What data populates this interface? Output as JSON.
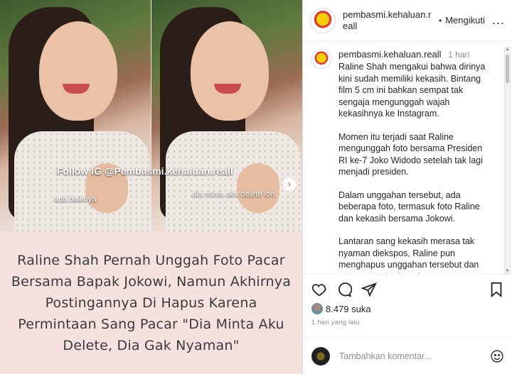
{
  "media": {
    "overlay_follow": "Follow IG @Pembasmi.kehaluan.reall",
    "caption_left": "ada baiknya",
    "caption_right": "dia minta aku delete lon",
    "next_icon": "chevron-right-icon",
    "headline": "Raline Shah Pernah Unggah Foto Pacar Bersama Bapak Jokowi, Namun Akhirnya Postingannya Di Hapus Karena Permintaan Sang Pacar \"Dia Minta Aku Delete, Dia Gak Nyaman\"",
    "headline_bg": "#f6e1e1"
  },
  "header": {
    "username": "pembasmi.kehaluan.reall",
    "separator": "•",
    "follow_label": "Mengikuti",
    "more_label": "..."
  },
  "post": {
    "username": "pembasmi.kehaluan.reall",
    "time": "1 hari",
    "paragraphs": [
      "Raline Shah mengakui bahwa dirinya kini sudah memiliki kekasih. Bintang film 5 cm ini bahkan sempat tak sengaja mengunggah wajah kekasihnya ke Instagram.",
      "Momen itu terjadi saat Raline mengunggah foto bersama Presiden RI ke-7 Joko Widodo setelah tak lagi menjadi presiden.",
      "Dalam unggahan tersebut, ada beberapa foto, termasuk foto Raline dan kekasih bersama Jokowi.",
      "Lantaran sang kekasih merasa tak nyaman diekspos, Raline pun menghapus unggahan tersebut dan mengunggah ulang fotonya."
    ]
  },
  "actions": {
    "icons": [
      "heart-icon",
      "comment-icon",
      "share-icon",
      "bookmark-icon"
    ],
    "likes_count": "8.479",
    "likes_label": "suka",
    "time_ago": "1 hari yang lalu"
  },
  "comment_box": {
    "placeholder": "Tambahkan komentar..."
  }
}
